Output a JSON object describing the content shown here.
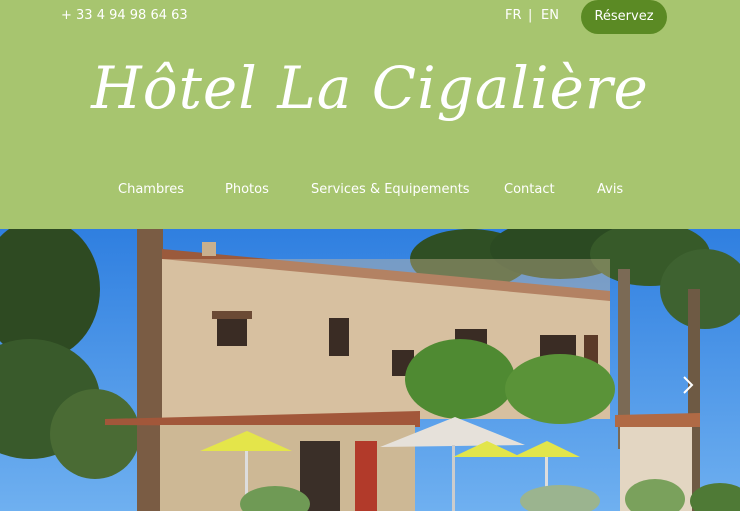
{
  "topbar": {
    "phone": "+ 33 4 94 98 64 63",
    "lang_fr": "FR",
    "lang_separator": "|",
    "lang_en": "EN",
    "reserve_label": "Réservez"
  },
  "brand": {
    "title": "Hôtel La Cigalière"
  },
  "nav": {
    "items": [
      {
        "label": "Chambres"
      },
      {
        "label": "Photos"
      },
      {
        "label": "Services & Equipements"
      },
      {
        "label": "Contact"
      },
      {
        "label": "Avis"
      }
    ]
  },
  "colors": {
    "header_bg": "#a7c56f",
    "button_bg": "#5b8a24",
    "text": "#ffffff"
  },
  "hero": {
    "icon": "next-arrow-icon"
  }
}
